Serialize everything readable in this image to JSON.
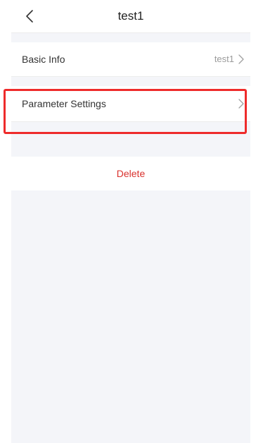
{
  "header": {
    "title": "test1",
    "back_icon": "chevron-left-icon"
  },
  "rows": {
    "basic_info": {
      "label": "Basic Info",
      "value": "test1",
      "icon": "chevron-right-icon"
    },
    "parameter_settings": {
      "label": "Parameter Settings",
      "icon": "chevron-right-icon"
    }
  },
  "actions": {
    "delete_label": "Delete"
  },
  "colors": {
    "background": "#f4f5f9",
    "danger": "#d9312d",
    "highlight": "#ee2b2b"
  }
}
